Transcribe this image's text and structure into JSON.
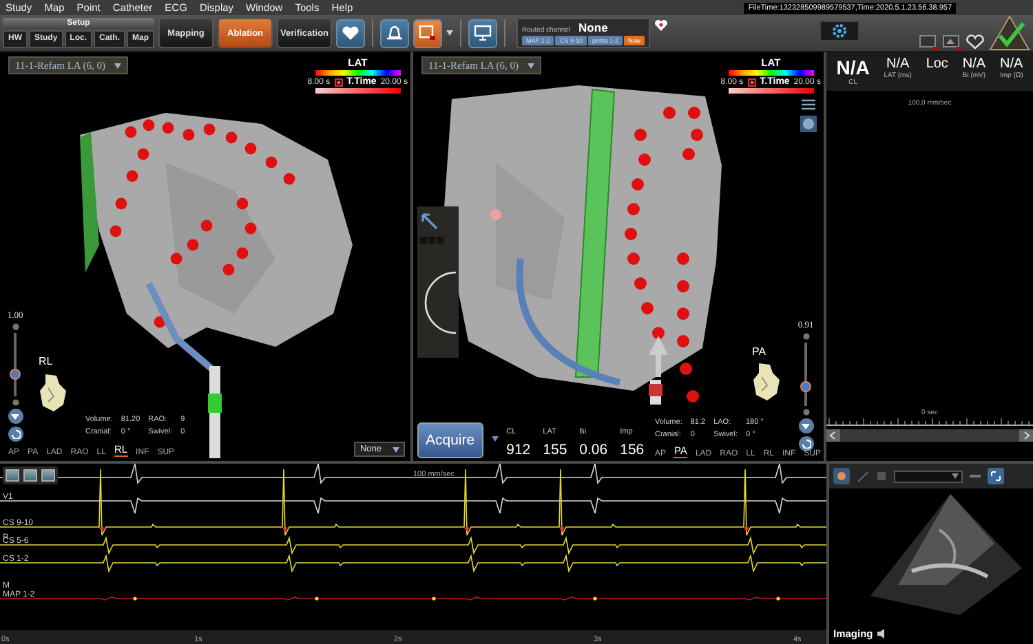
{
  "menu": [
    "Study",
    "Map",
    "Point",
    "Catheter",
    "ECG",
    "Display",
    "Window",
    "Tools",
    "Help"
  ],
  "file_time": "FileTime:132328509989579537,Time:2020.5.1.23.56.38.957",
  "setup": {
    "title": "Setup",
    "buttons": [
      "HW",
      "Study",
      "Loc.",
      "Cath.",
      "Map"
    ]
  },
  "modes": [
    {
      "label": "Mapping",
      "selected": false
    },
    {
      "label": "Ablation",
      "selected": true
    },
    {
      "label": "Verification",
      "selected": false
    }
  ],
  "routed_channel": {
    "title": "Routed channel",
    "value": "None",
    "chips": [
      {
        "label": "MAP 1-2",
        "selected": false
      },
      {
        "label": "CS 9-10",
        "selected": false
      },
      {
        "label": "penta 1-2",
        "selected": false
      },
      {
        "label": "Now",
        "selected": true
      }
    ]
  },
  "readouts": [
    {
      "value": "N/A",
      "label": "CL"
    },
    {
      "value": "N/A",
      "label": "LAT (ms)"
    },
    {
      "value": "Loc"
    },
    {
      "value": "N/A",
      "label": "Bi (mV)"
    },
    {
      "value": "N/A",
      "label": "Imp (Ω)"
    }
  ],
  "side_panel": {
    "speed": "100.0 mm/sec",
    "time": "0 sec"
  },
  "maps": [
    {
      "map_name": "11-1-Refam LA (6, 0)",
      "legend": {
        "title": "LAT",
        "min": "8.00 s",
        "label": "T.Time",
        "max": "20.00 s"
      },
      "zoom": {
        "value": "1.00",
        "level": 0.35
      },
      "orientation": "RL",
      "stats": [
        {
          "label": "Volume:",
          "value": "81.20"
        },
        {
          "label": "RAO:",
          "value": "9"
        },
        {
          "label": "Cranial:",
          "value": "0 °"
        },
        {
          "label": "Swivel:",
          "value": "0"
        }
      ],
      "views": [
        {
          "label": "AP",
          "selected": false
        },
        {
          "label": "PA",
          "selected": false
        },
        {
          "label": "LAD",
          "selected": false
        },
        {
          "label": "RAO",
          "selected": false
        },
        {
          "label": "LL",
          "selected": false
        },
        {
          "label": "RL",
          "selected": true
        },
        {
          "label": "INF",
          "selected": false
        },
        {
          "label": "SUP",
          "selected": false
        }
      ],
      "dropdown": "None"
    },
    {
      "map_name": "11-1-Refam LA (6, 0)",
      "legend": {
        "title": "LAT",
        "min": "8.00 s",
        "label": "T.Time",
        "max": "20.00 s"
      },
      "zoom": {
        "value": "0.91",
        "level": 0.3
      },
      "orientation": "PA",
      "stats": [
        {
          "label": "Volume:",
          "value": "81.2"
        },
        {
          "label": "LAO:",
          "value": "180 °"
        },
        {
          "label": "Cranial:",
          "value": "0"
        },
        {
          "label": "Swivel:",
          "value": "0 °"
        }
      ],
      "views": [
        {
          "label": "AP",
          "selected": false
        },
        {
          "label": "PA",
          "selected": true
        },
        {
          "label": "LAD",
          "selected": false
        },
        {
          "label": "RAO",
          "selected": false
        },
        {
          "label": "LL",
          "selected": false
        },
        {
          "label": "RL",
          "selected": false
        },
        {
          "label": "INF",
          "selected": false
        },
        {
          "label": "SUP",
          "selected": false
        }
      ],
      "acquire": "Acquire",
      "measurements": [
        {
          "label": "CL",
          "value": "912"
        },
        {
          "label": "LAT",
          "value": "155"
        },
        {
          "label": "Bi",
          "value": "0.06"
        },
        {
          "label": "Imp",
          "value": "156"
        }
      ]
    }
  ],
  "ecg": {
    "speed": "100 mm/sec",
    "channels": [
      {
        "kind": "upright",
        "color": "#d8d8d8"
      },
      {
        "kind": "inverted",
        "label": "V1",
        "color": "#d8d8d8"
      },
      {
        "kind": "spike",
        "label": "CS 9-10",
        "color": "#e4dc2c"
      },
      {
        "kind": "tag",
        "label": "R"
      },
      {
        "kind": "deflection",
        "label": "CS 5-6",
        "color": "#e4dc2c"
      },
      {
        "kind": "deflection",
        "label": "CS 1-2",
        "color": "#e4dc2c"
      },
      {
        "kind": "tag",
        "label": "M"
      },
      {
        "kind": "flat",
        "label": "MAP 1-2",
        "color": "#c02020"
      }
    ],
    "time_labels": [
      "0s",
      "1s",
      "2s",
      "3s",
      "4s"
    ]
  },
  "imaging": {
    "label": "Imaging"
  }
}
